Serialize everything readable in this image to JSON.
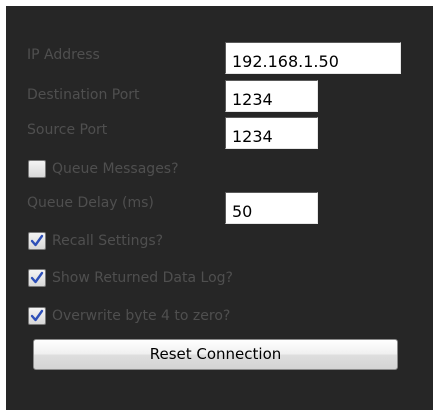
{
  "fields": {
    "ip_address": {
      "label": "IP Address",
      "value": "192.168.1.50"
    },
    "destination_port": {
      "label": "Destination Port",
      "value": "1234"
    },
    "source_port": {
      "label": "Source Port",
      "value": "1234"
    },
    "queue_delay": {
      "label": "Queue Delay (ms)",
      "value": "50"
    }
  },
  "checkboxes": {
    "queue_messages": {
      "label": "Queue Messages?",
      "checked": false
    },
    "recall_settings": {
      "label": "Recall Settings?",
      "checked": true
    },
    "show_returned_data_log": {
      "label": "Show Returned Data Log?",
      "checked": true
    },
    "overwrite_byte_4": {
      "label": "Overwrite byte 4 to zero?",
      "checked": true
    }
  },
  "buttons": {
    "reset_connection": "Reset Connection"
  },
  "colors": {
    "panel_background": "#262626",
    "label_text": "#4f4f4f",
    "check_mark": "#2d4fb8"
  }
}
